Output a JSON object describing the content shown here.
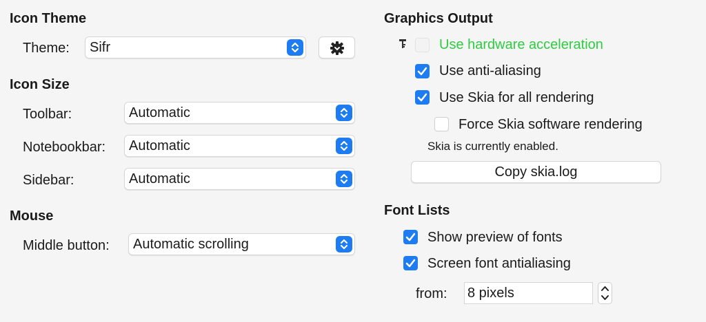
{
  "icon_theme": {
    "heading": "Icon Theme",
    "theme_label": "Theme:",
    "theme_value": "Sifr"
  },
  "icon_size": {
    "heading": "Icon Size",
    "toolbar_label": "Toolbar:",
    "toolbar_value": "Automatic",
    "notebookbar_label": "Notebookbar:",
    "notebookbar_value": "Automatic",
    "sidebar_label": "Sidebar:",
    "sidebar_value": "Automatic"
  },
  "mouse": {
    "heading": "Mouse",
    "middle_button_label": "Middle button:",
    "middle_button_value": "Automatic scrolling"
  },
  "graphics_output": {
    "heading": "Graphics Output",
    "hardware_acceleration": {
      "label": "Use hardware acceleration",
      "checked": false,
      "enabled": false,
      "label_color": "#2ecc40"
    },
    "anti_aliasing": {
      "label": "Use anti-aliasing",
      "checked": true
    },
    "skia_all_rendering": {
      "label": "Use Skia for all rendering",
      "checked": true
    },
    "force_skia_software": {
      "label": "Force Skia software rendering",
      "checked": false
    },
    "skia_status": "Skia is currently enabled.",
    "copy_log_button": "Copy skia.log"
  },
  "font_lists": {
    "heading": "Font Lists",
    "show_preview": {
      "label": "Show preview of fonts",
      "checked": true
    },
    "screen_antialiasing": {
      "label": "Screen font antialiasing",
      "checked": true
    },
    "from_label": "from:",
    "from_value": "8 pixels"
  },
  "colors": {
    "accent": "#1e7cf2",
    "green_label": "#2ecc40"
  }
}
